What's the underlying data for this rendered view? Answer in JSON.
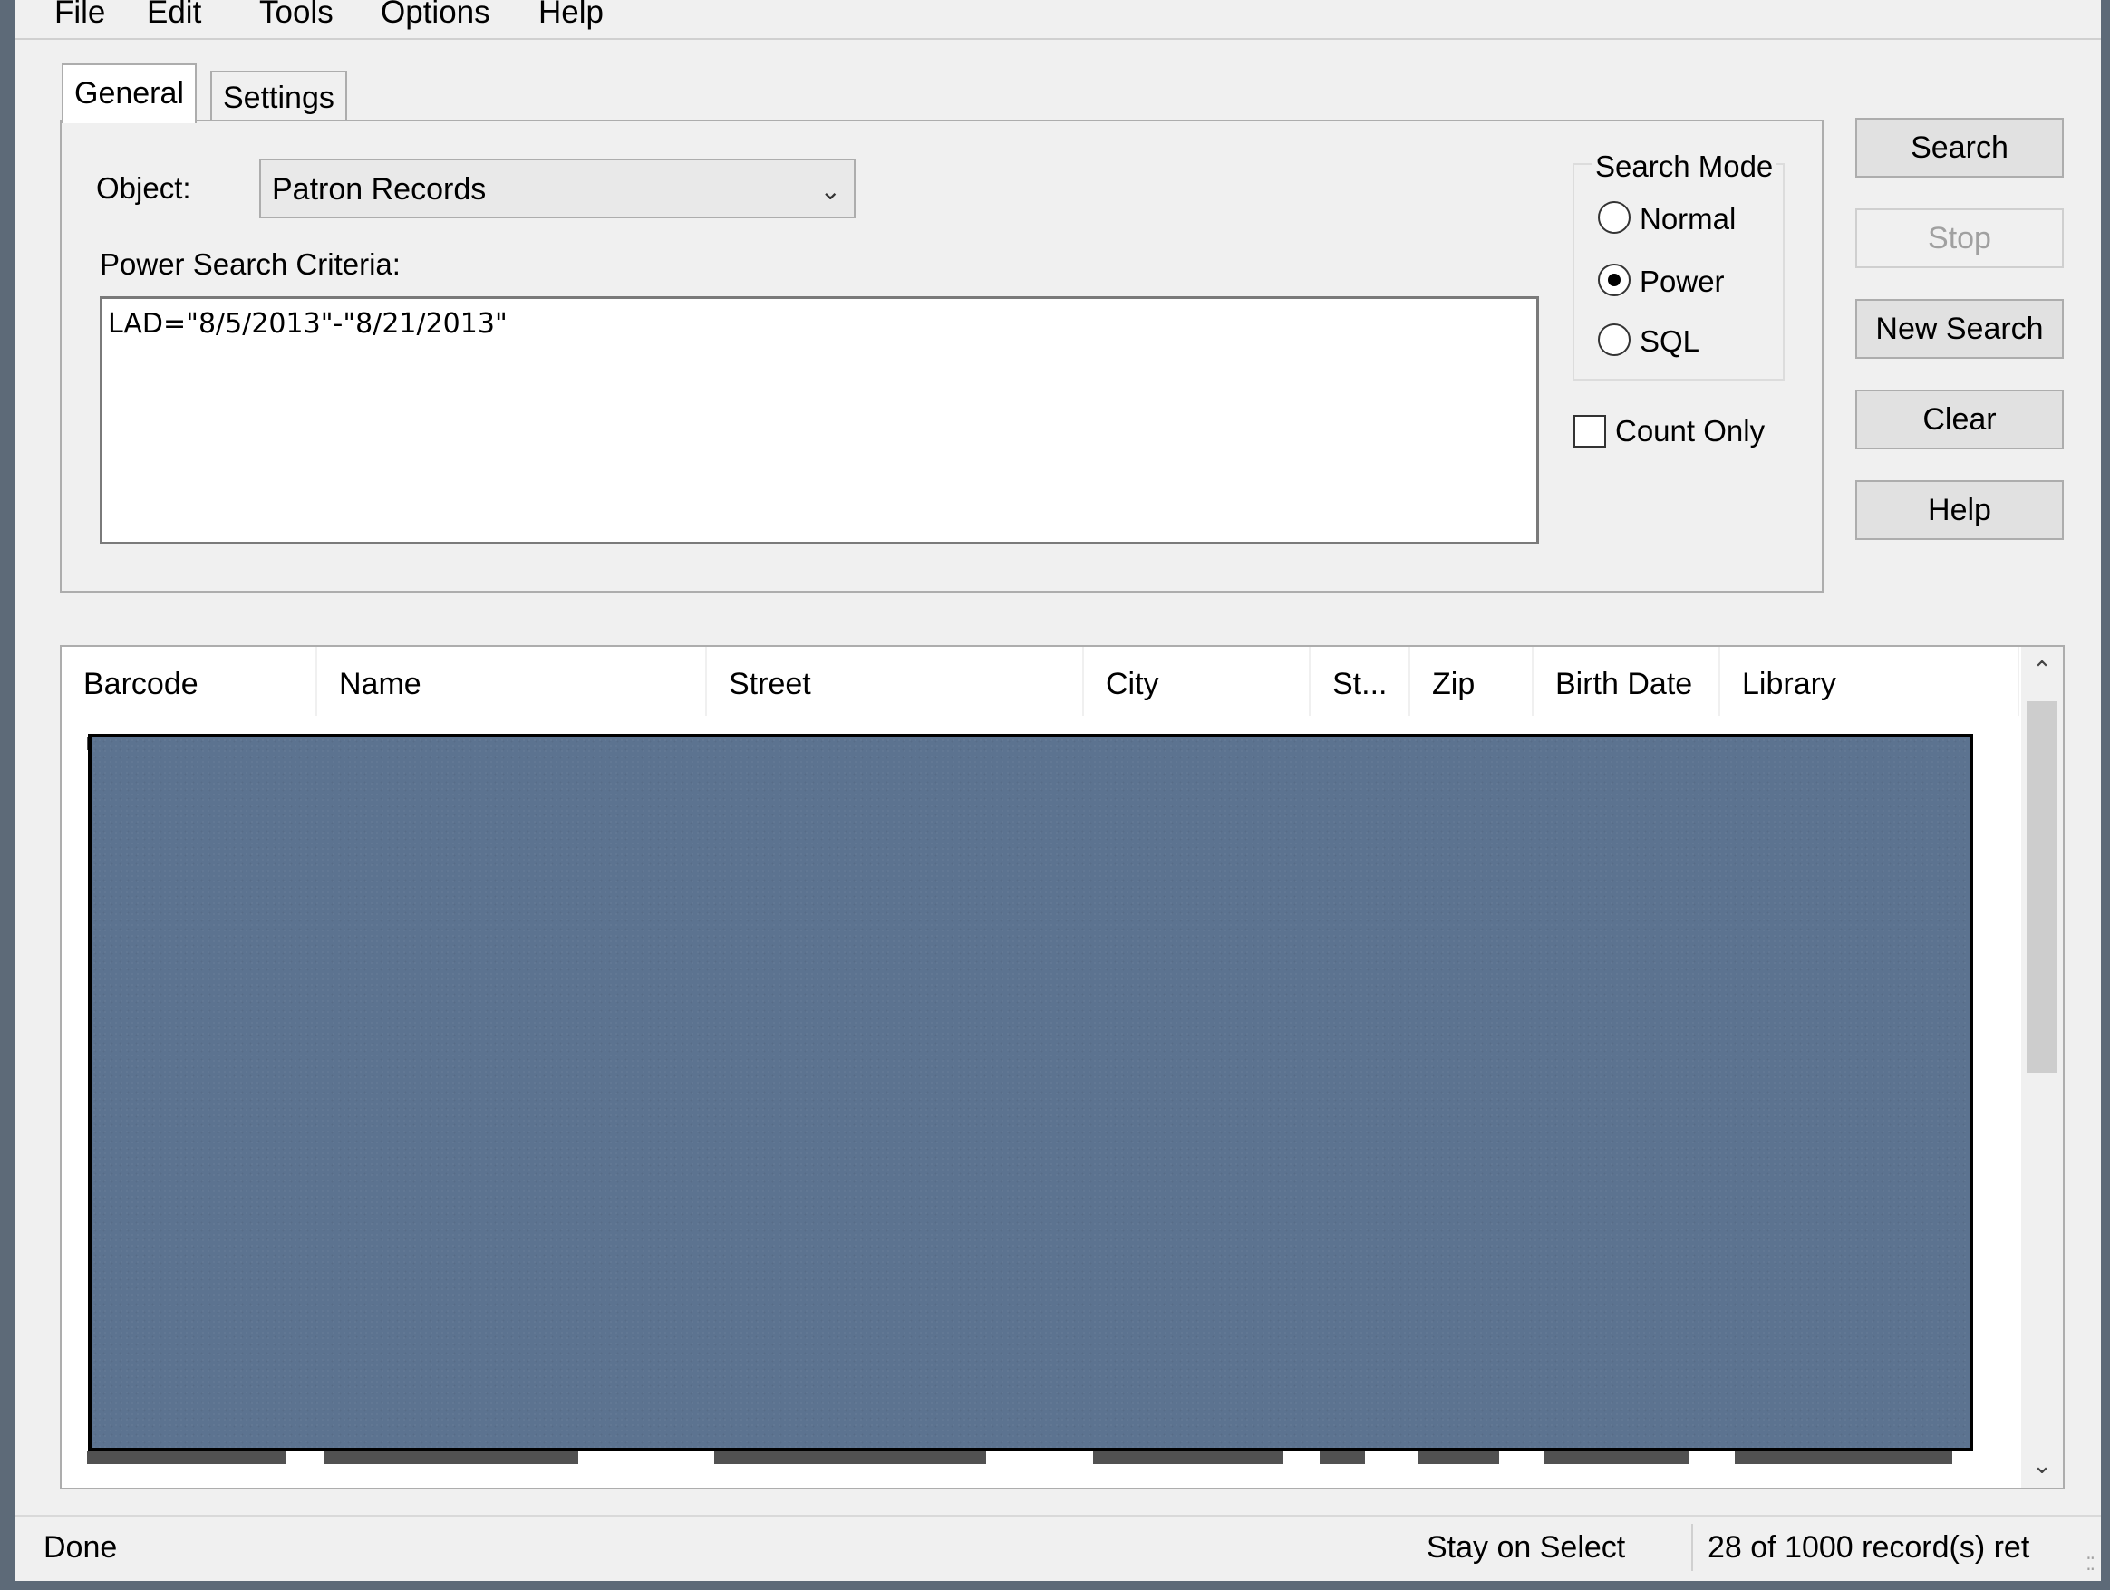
{
  "menu": [
    "File",
    "Edit",
    "Tools",
    "Options",
    "Help"
  ],
  "tabs": [
    "General",
    "Settings"
  ],
  "general": {
    "object_label": "Object:",
    "object_value": "Patron Records",
    "criteria_label": "Power Search Criteria:",
    "criteria_value": "LAD=\"8/5/2013\"-\"8/21/2013\""
  },
  "search_mode": {
    "legend": "Search Mode",
    "options": [
      "Normal",
      "Power",
      "SQL"
    ],
    "selected": "Power"
  },
  "count_only": {
    "label": "Count Only",
    "checked": false
  },
  "buttons": {
    "search": "Search",
    "stop": "Stop",
    "new_search": "New Search",
    "clear": "Clear",
    "help": "Help"
  },
  "columns": [
    "Barcode",
    "Name",
    "Street",
    "City",
    "St...",
    "Zip",
    "Birth Date",
    "Library"
  ],
  "status": {
    "left": "Done",
    "mode": "Stay on Select",
    "records": "28 of 1000 record(s) ret"
  }
}
